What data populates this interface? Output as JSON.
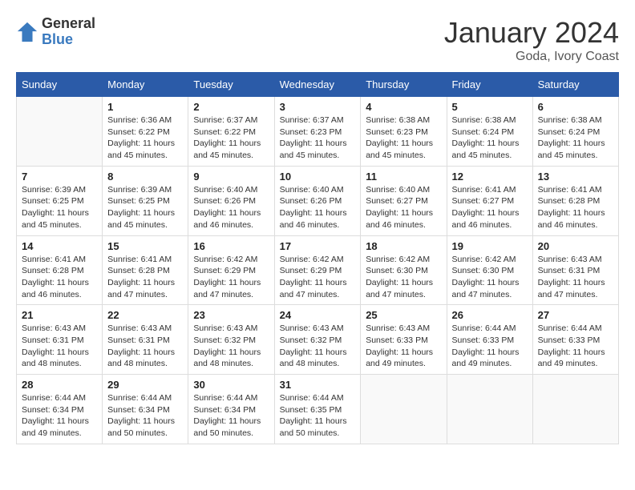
{
  "header": {
    "logo_general": "General",
    "logo_blue": "Blue",
    "month_year": "January 2024",
    "location": "Goda, Ivory Coast"
  },
  "days_of_week": [
    "Sunday",
    "Monday",
    "Tuesday",
    "Wednesday",
    "Thursday",
    "Friday",
    "Saturday"
  ],
  "weeks": [
    [
      {
        "day": "",
        "detail": ""
      },
      {
        "day": "1",
        "detail": "Sunrise: 6:36 AM\nSunset: 6:22 PM\nDaylight: 11 hours and 45 minutes."
      },
      {
        "day": "2",
        "detail": "Sunrise: 6:37 AM\nSunset: 6:22 PM\nDaylight: 11 hours and 45 minutes."
      },
      {
        "day": "3",
        "detail": "Sunrise: 6:37 AM\nSunset: 6:23 PM\nDaylight: 11 hours and 45 minutes."
      },
      {
        "day": "4",
        "detail": "Sunrise: 6:38 AM\nSunset: 6:23 PM\nDaylight: 11 hours and 45 minutes."
      },
      {
        "day": "5",
        "detail": "Sunrise: 6:38 AM\nSunset: 6:24 PM\nDaylight: 11 hours and 45 minutes."
      },
      {
        "day": "6",
        "detail": "Sunrise: 6:38 AM\nSunset: 6:24 PM\nDaylight: 11 hours and 45 minutes."
      }
    ],
    [
      {
        "day": "7",
        "detail": "Sunrise: 6:39 AM\nSunset: 6:25 PM\nDaylight: 11 hours and 45 minutes."
      },
      {
        "day": "8",
        "detail": "Sunrise: 6:39 AM\nSunset: 6:25 PM\nDaylight: 11 hours and 45 minutes."
      },
      {
        "day": "9",
        "detail": "Sunrise: 6:40 AM\nSunset: 6:26 PM\nDaylight: 11 hours and 46 minutes."
      },
      {
        "day": "10",
        "detail": "Sunrise: 6:40 AM\nSunset: 6:26 PM\nDaylight: 11 hours and 46 minutes."
      },
      {
        "day": "11",
        "detail": "Sunrise: 6:40 AM\nSunset: 6:27 PM\nDaylight: 11 hours and 46 minutes."
      },
      {
        "day": "12",
        "detail": "Sunrise: 6:41 AM\nSunset: 6:27 PM\nDaylight: 11 hours and 46 minutes."
      },
      {
        "day": "13",
        "detail": "Sunrise: 6:41 AM\nSunset: 6:28 PM\nDaylight: 11 hours and 46 minutes."
      }
    ],
    [
      {
        "day": "14",
        "detail": "Sunrise: 6:41 AM\nSunset: 6:28 PM\nDaylight: 11 hours and 46 minutes."
      },
      {
        "day": "15",
        "detail": "Sunrise: 6:41 AM\nSunset: 6:28 PM\nDaylight: 11 hours and 47 minutes."
      },
      {
        "day": "16",
        "detail": "Sunrise: 6:42 AM\nSunset: 6:29 PM\nDaylight: 11 hours and 47 minutes."
      },
      {
        "day": "17",
        "detail": "Sunrise: 6:42 AM\nSunset: 6:29 PM\nDaylight: 11 hours and 47 minutes."
      },
      {
        "day": "18",
        "detail": "Sunrise: 6:42 AM\nSunset: 6:30 PM\nDaylight: 11 hours and 47 minutes."
      },
      {
        "day": "19",
        "detail": "Sunrise: 6:42 AM\nSunset: 6:30 PM\nDaylight: 11 hours and 47 minutes."
      },
      {
        "day": "20",
        "detail": "Sunrise: 6:43 AM\nSunset: 6:31 PM\nDaylight: 11 hours and 47 minutes."
      }
    ],
    [
      {
        "day": "21",
        "detail": "Sunrise: 6:43 AM\nSunset: 6:31 PM\nDaylight: 11 hours and 48 minutes."
      },
      {
        "day": "22",
        "detail": "Sunrise: 6:43 AM\nSunset: 6:31 PM\nDaylight: 11 hours and 48 minutes."
      },
      {
        "day": "23",
        "detail": "Sunrise: 6:43 AM\nSunset: 6:32 PM\nDaylight: 11 hours and 48 minutes."
      },
      {
        "day": "24",
        "detail": "Sunrise: 6:43 AM\nSunset: 6:32 PM\nDaylight: 11 hours and 48 minutes."
      },
      {
        "day": "25",
        "detail": "Sunrise: 6:43 AM\nSunset: 6:33 PM\nDaylight: 11 hours and 49 minutes."
      },
      {
        "day": "26",
        "detail": "Sunrise: 6:44 AM\nSunset: 6:33 PM\nDaylight: 11 hours and 49 minutes."
      },
      {
        "day": "27",
        "detail": "Sunrise: 6:44 AM\nSunset: 6:33 PM\nDaylight: 11 hours and 49 minutes."
      }
    ],
    [
      {
        "day": "28",
        "detail": "Sunrise: 6:44 AM\nSunset: 6:34 PM\nDaylight: 11 hours and 49 minutes."
      },
      {
        "day": "29",
        "detail": "Sunrise: 6:44 AM\nSunset: 6:34 PM\nDaylight: 11 hours and 50 minutes."
      },
      {
        "day": "30",
        "detail": "Sunrise: 6:44 AM\nSunset: 6:34 PM\nDaylight: 11 hours and 50 minutes."
      },
      {
        "day": "31",
        "detail": "Sunrise: 6:44 AM\nSunset: 6:35 PM\nDaylight: 11 hours and 50 minutes."
      },
      {
        "day": "",
        "detail": ""
      },
      {
        "day": "",
        "detail": ""
      },
      {
        "day": "",
        "detail": ""
      }
    ]
  ]
}
